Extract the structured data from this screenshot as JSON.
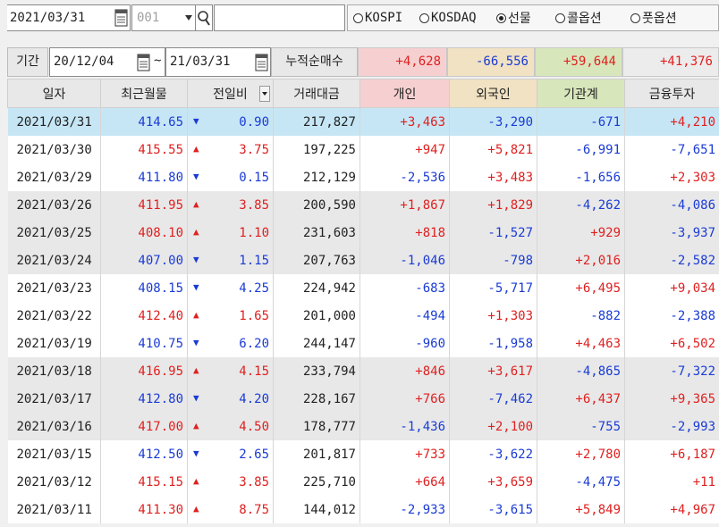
{
  "toolbar": {
    "date": "2021/03/31",
    "code": "001",
    "search_value": "",
    "markets": [
      {
        "label": "KOSPI",
        "selected": false
      },
      {
        "label": "KOSDAQ",
        "selected": false
      },
      {
        "label": "선물",
        "selected": true
      },
      {
        "label": "콜옵션",
        "selected": false
      },
      {
        "label": "풋옵션",
        "selected": false
      }
    ]
  },
  "period": {
    "label": "기간",
    "from": "20/12/04",
    "tilde": "~",
    "to": "21/03/31",
    "cumulative_label": "누적순매수",
    "sums": [
      "+4,628",
      "-66,556",
      "+59,644",
      "+41,376"
    ],
    "sum_colors": [
      "#f6d0d0",
      "#f0e2c2",
      "#d8e6bc",
      "#ececec"
    ]
  },
  "table": {
    "headers": [
      "일자",
      "최근월물",
      "전일비",
      "거래대금",
      "개인",
      "외국인",
      "기관계",
      "금융투자"
    ],
    "header_colors": [
      "#e8e8e8",
      "#e8e8e8",
      "#e8e8e8",
      "#e8e8e8",
      "#f6d0d0",
      "#f0e2c2",
      "#d8e6bc",
      "#e8e8e8"
    ],
    "rows": [
      {
        "date": "2021/03/31",
        "price": "414.65",
        "dir": "down",
        "chg": "0.90",
        "amount": "217,827",
        "ind": "+3,463",
        "for": "-3,290",
        "inst": "-671",
        "fin": "+4,210",
        "style": "sel"
      },
      {
        "date": "2021/03/30",
        "price": "415.55",
        "dir": "up",
        "chg": "3.75",
        "amount": "197,225",
        "ind": "+947",
        "for": "+5,821",
        "inst": "-6,991",
        "fin": "-7,651",
        "style": "white"
      },
      {
        "date": "2021/03/29",
        "price": "411.80",
        "dir": "down",
        "chg": "0.15",
        "amount": "212,129",
        "ind": "-2,536",
        "for": "+3,483",
        "inst": "-1,656",
        "fin": "+2,303",
        "style": "white"
      },
      {
        "date": "2021/03/26",
        "price": "411.95",
        "dir": "up",
        "chg": "3.85",
        "amount": "200,590",
        "ind": "+1,867",
        "for": "+1,829",
        "inst": "-4,262",
        "fin": "-4,086",
        "style": "shade"
      },
      {
        "date": "2021/03/25",
        "price": "408.10",
        "dir": "up",
        "chg": "1.10",
        "amount": "231,603",
        "ind": "+818",
        "for": "-1,527",
        "inst": "+929",
        "fin": "-3,937",
        "style": "shade"
      },
      {
        "date": "2021/03/24",
        "price": "407.00",
        "dir": "down",
        "chg": "1.15",
        "amount": "207,763",
        "ind": "-1,046",
        "for": "-798",
        "inst": "+2,016",
        "fin": "-2,582",
        "style": "shade"
      },
      {
        "date": "2021/03/23",
        "price": "408.15",
        "dir": "down",
        "chg": "4.25",
        "amount": "224,942",
        "ind": "-683",
        "for": "-5,717",
        "inst": "+6,495",
        "fin": "+9,034",
        "style": "white"
      },
      {
        "date": "2021/03/22",
        "price": "412.40",
        "dir": "up",
        "chg": "1.65",
        "amount": "201,000",
        "ind": "-494",
        "for": "+1,303",
        "inst": "-882",
        "fin": "-2,388",
        "style": "white"
      },
      {
        "date": "2021/03/19",
        "price": "410.75",
        "dir": "down",
        "chg": "6.20",
        "amount": "244,147",
        "ind": "-960",
        "for": "-1,958",
        "inst": "+4,463",
        "fin": "+6,502",
        "style": "white"
      },
      {
        "date": "2021/03/18",
        "price": "416.95",
        "dir": "up",
        "chg": "4.15",
        "amount": "233,794",
        "ind": "+846",
        "for": "+3,617",
        "inst": "-4,865",
        "fin": "-7,322",
        "style": "shade"
      },
      {
        "date": "2021/03/17",
        "price": "412.80",
        "dir": "down",
        "chg": "4.20",
        "amount": "228,167",
        "ind": "+766",
        "for": "-7,462",
        "inst": "+6,437",
        "fin": "+9,365",
        "style": "shade"
      },
      {
        "date": "2021/03/16",
        "price": "417.00",
        "dir": "up",
        "chg": "4.50",
        "amount": "178,777",
        "ind": "-1,436",
        "for": "+2,100",
        "inst": "-755",
        "fin": "-2,993",
        "style": "shade"
      },
      {
        "date": "2021/03/15",
        "price": "412.50",
        "dir": "down",
        "chg": "2.65",
        "amount": "201,817",
        "ind": "+733",
        "for": "-3,622",
        "inst": "+2,780",
        "fin": "+6,187",
        "style": "white"
      },
      {
        "date": "2021/03/12",
        "price": "415.15",
        "dir": "up",
        "chg": "3.85",
        "amount": "225,710",
        "ind": "+664",
        "for": "+3,659",
        "inst": "-4,475",
        "fin": "+11",
        "style": "white"
      },
      {
        "date": "2021/03/11",
        "price": "411.30",
        "dir": "up",
        "chg": "8.75",
        "amount": "144,012",
        "ind": "-2,933",
        "for": "-3,615",
        "inst": "+5,849",
        "fin": "+4,967",
        "style": "white"
      }
    ]
  }
}
